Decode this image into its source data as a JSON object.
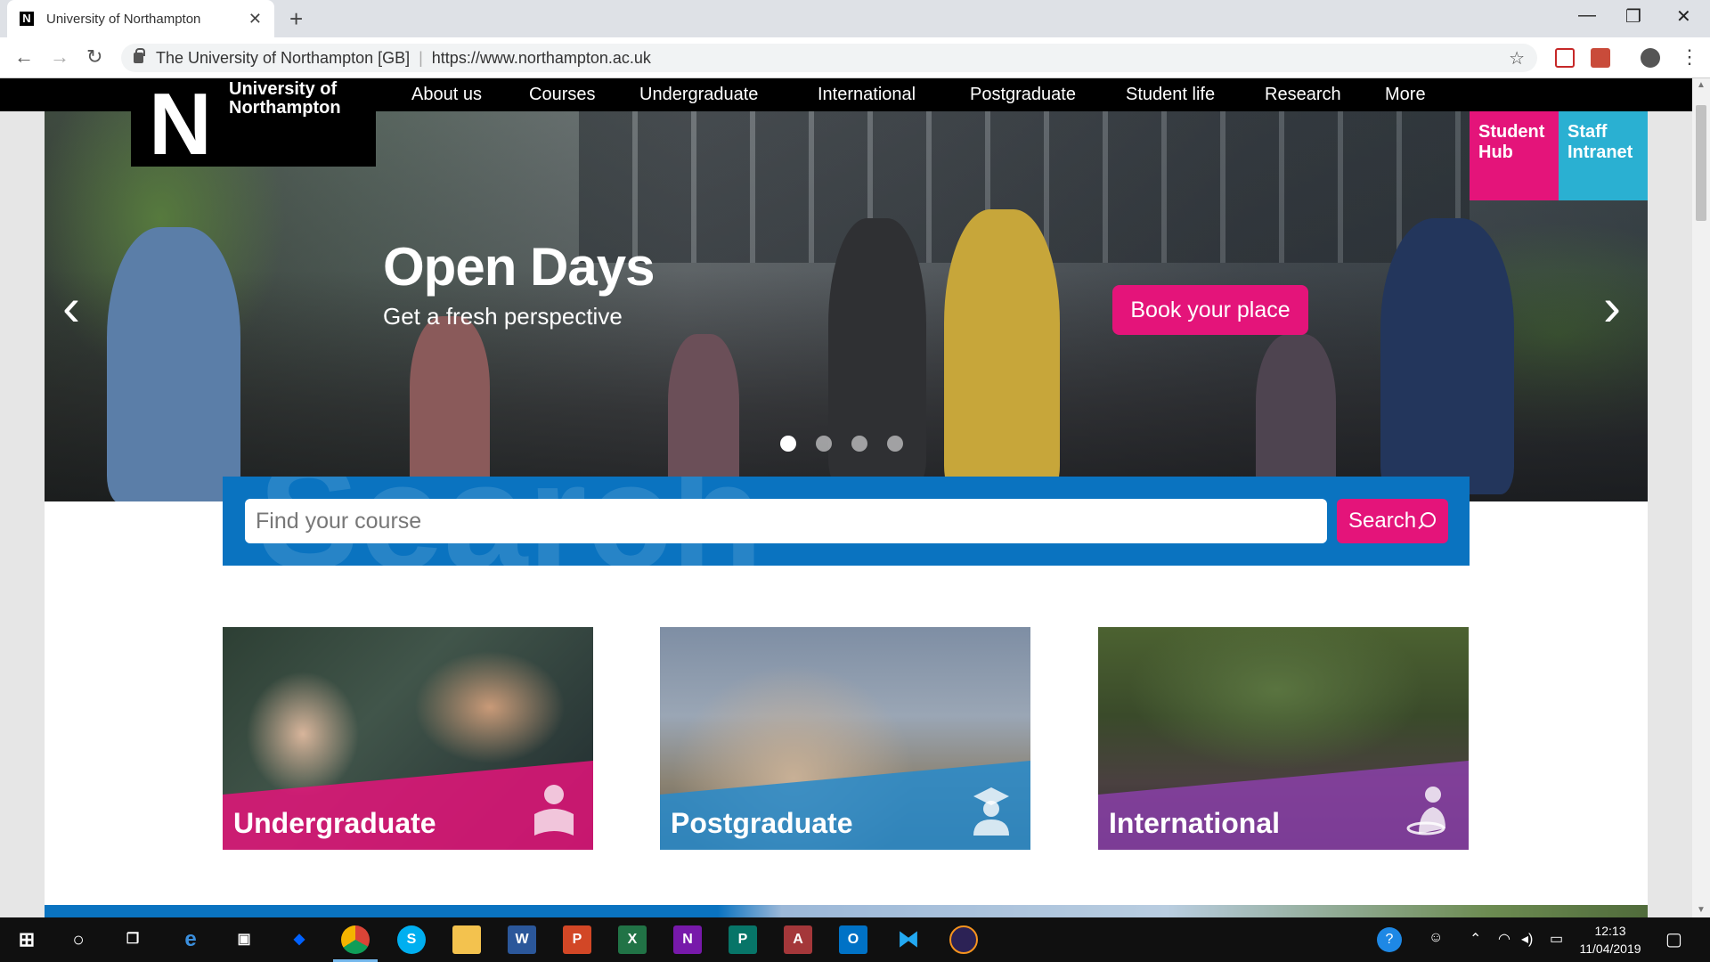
{
  "browser": {
    "tab_title": "University of Northampton",
    "tab_favicon": "N",
    "tab_close": "✕",
    "new_tab": "+",
    "site_identity": "The University of Northampton [GB]",
    "url": "https://www.northampton.ac.uk",
    "window_controls": {
      "minimize": "—",
      "maximize": "❐",
      "close": "✕"
    },
    "nav": {
      "back": "←",
      "forward": "→",
      "reload": "↻"
    }
  },
  "site": {
    "logo_letter": "N",
    "logo_text": "University of Northampton",
    "nav_items": [
      "About us",
      "Courses",
      "Undergraduate",
      "International",
      "Postgraduate",
      "Student life",
      "Research",
      "More"
    ],
    "quick_links": [
      {
        "label": "Student Hub",
        "color": "#e4147a"
      },
      {
        "label": "Staff Intranet",
        "color": "#2ab0d2"
      }
    ],
    "hero": {
      "title": "Open Days",
      "subtitle": "Get a fresh perspective",
      "cta": "Book your place",
      "slides": 4,
      "active_slide": 1
    },
    "search": {
      "ghost_text": "Search",
      "placeholder": "Find your course",
      "button": "Search"
    },
    "cards": [
      {
        "title": "Undergraduate",
        "color": "#e4147a",
        "icon": "student-reading-icon"
      },
      {
        "title": "Postgraduate",
        "color": "#2a8ac8",
        "icon": "graduate-icon"
      },
      {
        "title": "International",
        "color": "#8a3fa8",
        "icon": "globe-person-icon"
      }
    ],
    "brand_pink": "#e4147a",
    "brand_blue": "#0a73c0"
  },
  "taskbar": {
    "apps": [
      "start",
      "search",
      "task-view",
      "edge",
      "store",
      "dropbox",
      "chrome",
      "skype",
      "explorer",
      "word",
      "powerpoint",
      "excel",
      "onenote",
      "publisher",
      "access",
      "outlook",
      "vscode",
      "eclipse"
    ],
    "time": "12:13",
    "date": "11/04/2019"
  }
}
